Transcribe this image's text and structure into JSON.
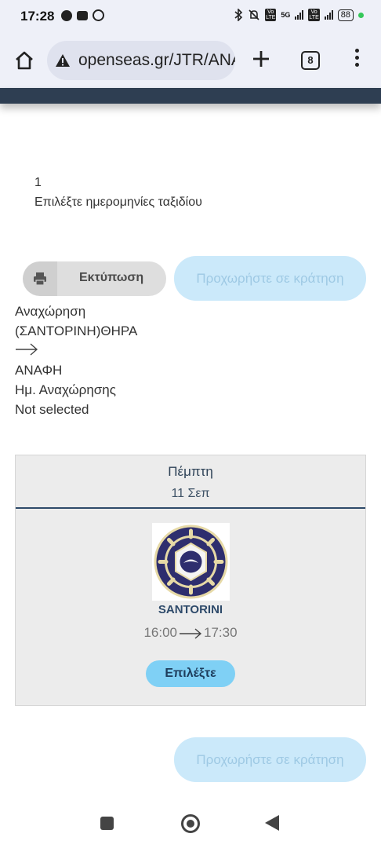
{
  "status_bar": {
    "time": "17:28",
    "network": "5G",
    "battery": "88"
  },
  "browser": {
    "url": "openseas.gr/JTR/ANA",
    "tab_count": "8"
  },
  "step": {
    "number": "1",
    "label": "Επιλέξτε ημερομηνίες ταξιδίου"
  },
  "actions": {
    "print_label": "Εκτύπωση",
    "proceed_label": "Προχωρήστε σε κράτηση"
  },
  "route": {
    "departure_label": "Αναχώρηση",
    "origin": "(ΣΑΝΤΟΡΙΝΗ)ΘΗΡΑ",
    "destination": "ΑΝΑΦΗ",
    "departure_date_label": "Ημ. Αναχώρησης",
    "departure_date_value": "Not selected"
  },
  "trip": {
    "day": "Πέμπτη",
    "date": "11 Σεπ",
    "logo_text": "SANTORINI BOATMEN'S ASSOCIATION",
    "vessel": "SANTORINI",
    "depart_time": "16:00",
    "arrive_time": "17:30",
    "select_label": "Επιλέξτε"
  },
  "colors": {
    "header_dark": "#2e3e52",
    "proceed_bg": "#cbe9fa",
    "select_bg": "#7fd0f5",
    "card_bg": "#ececec"
  }
}
